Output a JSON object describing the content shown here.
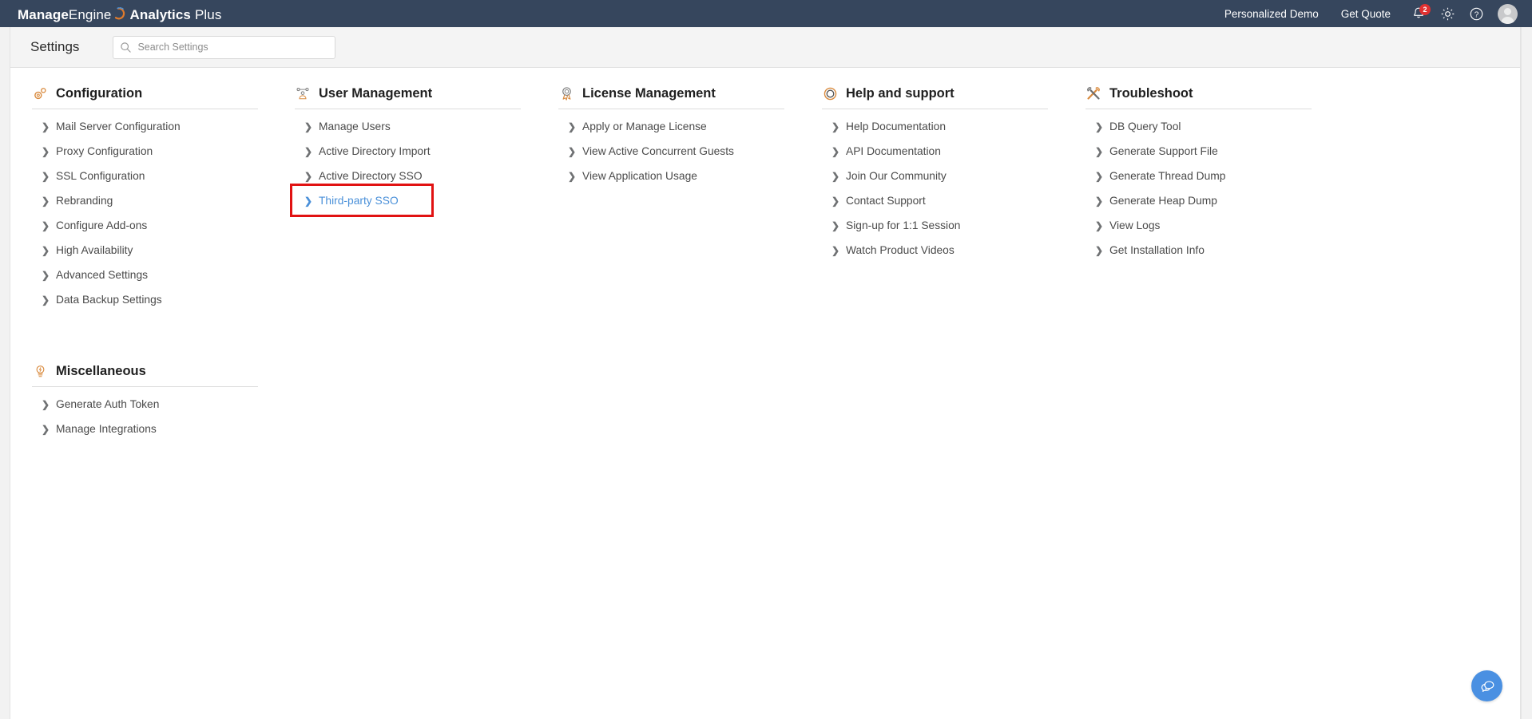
{
  "header": {
    "brand": {
      "part1": "Manage",
      "part2": "Engine",
      "part3": "Analytics",
      "part4": "Plus",
      "logo_icon": "manage-engine-swirl-icon"
    },
    "links": [
      {
        "label": "Personalized Demo",
        "name": "personalized-demo-link"
      },
      {
        "label": "Get Quote",
        "name": "get-quote-link"
      }
    ],
    "icons": [
      {
        "name": "notifications-bell-icon",
        "badge": "2"
      },
      {
        "name": "settings-gear-icon"
      },
      {
        "name": "help-question-icon"
      }
    ],
    "avatar_label": "user-avatar"
  },
  "settings_bar": {
    "title": "Settings",
    "search": {
      "placeholder": "Search Settings",
      "value": "",
      "icon": "search-icon"
    }
  },
  "accent_color": "#4a90d9",
  "highlight_color": "#e11212",
  "columns": [
    {
      "sections": [
        {
          "title": "Configuration",
          "icon": "cog-gears-icon",
          "items": [
            "Mail Server Configuration",
            "Proxy Configuration",
            "SSL Configuration",
            "Rebranding",
            "Configure Add-ons",
            "High Availability",
            "Advanced Settings",
            "Data Backup Settings"
          ]
        },
        {
          "title": "Miscellaneous",
          "icon": "lightbulb-icon",
          "items": [
            "Generate Auth Token",
            "Manage Integrations"
          ]
        }
      ]
    },
    {
      "sections": [
        {
          "title": "User Management",
          "icon": "users-group-icon",
          "items": [
            "Manage Users",
            "Active Directory Import",
            "Active Directory SSO",
            "Third-party SSO"
          ],
          "active_item": "Third-party SSO",
          "annotated_item": "Third-party SSO"
        }
      ]
    },
    {
      "sections": [
        {
          "title": "License Management",
          "icon": "award-ribbon-icon",
          "items": [
            "Apply or Manage License",
            "View Active Concurrent Guests",
            "View Application Usage"
          ]
        }
      ]
    },
    {
      "sections": [
        {
          "title": "Help and support",
          "icon": "lifebuoy-circle-icon",
          "items": [
            "Help Documentation",
            "API Documentation",
            "Join Our Community",
            "Contact Support",
            "Sign-up for 1:1 Session",
            "Watch Product Videos"
          ]
        }
      ]
    },
    {
      "sections": [
        {
          "title": "Troubleshoot",
          "icon": "hammer-wrench-icon",
          "items": [
            "DB Query Tool",
            "Generate Support File",
            "Generate Thread Dump",
            "Generate Heap Dump",
            "View Logs",
            "Get Installation Info"
          ]
        }
      ]
    }
  ],
  "chat_widget": {
    "icon": "chat-bubbles-icon",
    "color": "#4a90e2"
  }
}
